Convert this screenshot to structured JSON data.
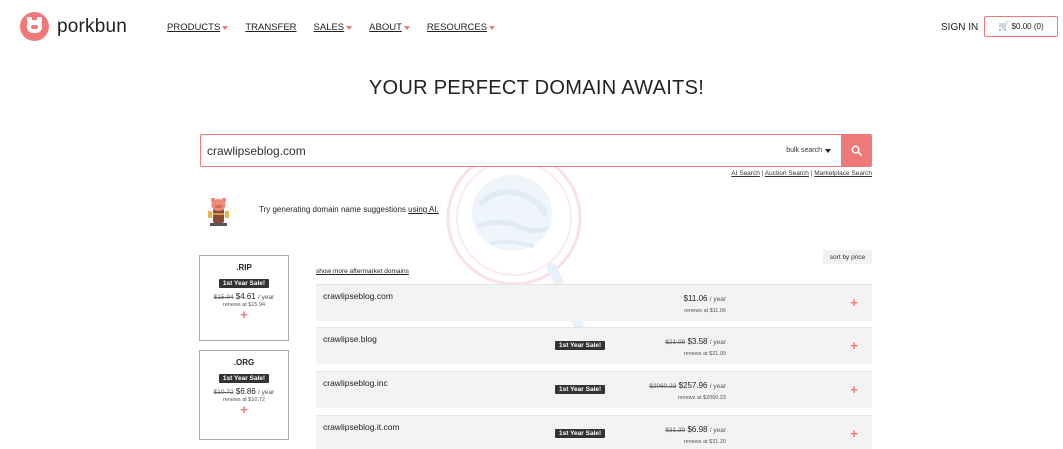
{
  "brand": {
    "name": "porkbun",
    "accent": "#ef7878"
  },
  "nav": [
    {
      "label": "PRODUCTS",
      "dropdown": true
    },
    {
      "label": "TRANSFER",
      "dropdown": false
    },
    {
      "label": "SALES",
      "dropdown": true
    },
    {
      "label": "ABOUT",
      "dropdown": true
    },
    {
      "label": "RESOURCES",
      "dropdown": true
    }
  ],
  "account": {
    "sign_in": "SIGN IN",
    "cart": "$0.00 (0)"
  },
  "hero": {
    "title": "YOUR PERFECT DOMAIN AWAITS!"
  },
  "search": {
    "value": "crawlipseblog.com",
    "bulk_label": "bulk search",
    "links": [
      "AI Search",
      "Auction Search",
      "Marketplace Search"
    ]
  },
  "ai_hint": {
    "text": "Try generating domain name suggestions ",
    "link": "using AI."
  },
  "sort_label": "sort by price",
  "show_more": "show more aftermarket domains",
  "tld_cards": [
    {
      "tld": ".RIP",
      "badge": "1st Year Sale!",
      "old_price": "$15.94",
      "price": "$4.61",
      "per": "/ year",
      "renew": "renews at $15.94"
    },
    {
      "tld": ".ORG",
      "badge": "1st Year Sale!",
      "old_price": "$10.72",
      "price": "$6.86",
      "per": "/ year",
      "renew": "renews at $10.72"
    }
  ],
  "results": [
    {
      "domain": "crawlipseblog.com",
      "badge": "",
      "old_price": "",
      "price": "$11.06",
      "per": "/ year",
      "renew": "renews at $11.06"
    },
    {
      "domain": "crawlipse.blog",
      "badge": "1st Year Sale!",
      "old_price": "$21.09",
      "price": "$3.58",
      "per": "/ year",
      "renew": "renews at $21.09"
    },
    {
      "domain": "crawlipseblog.inc",
      "badge": "1st Year Sale!",
      "old_price": "$2060.23",
      "price": "$257.96",
      "per": "/ year",
      "renew": "renews at $2060.23"
    },
    {
      "domain": "crawlipseblog.it.com",
      "badge": "1st Year Sale!",
      "old_price": "$31.20",
      "price": "$6.98",
      "per": "/ year",
      "renew": "renews at $31.20"
    }
  ]
}
